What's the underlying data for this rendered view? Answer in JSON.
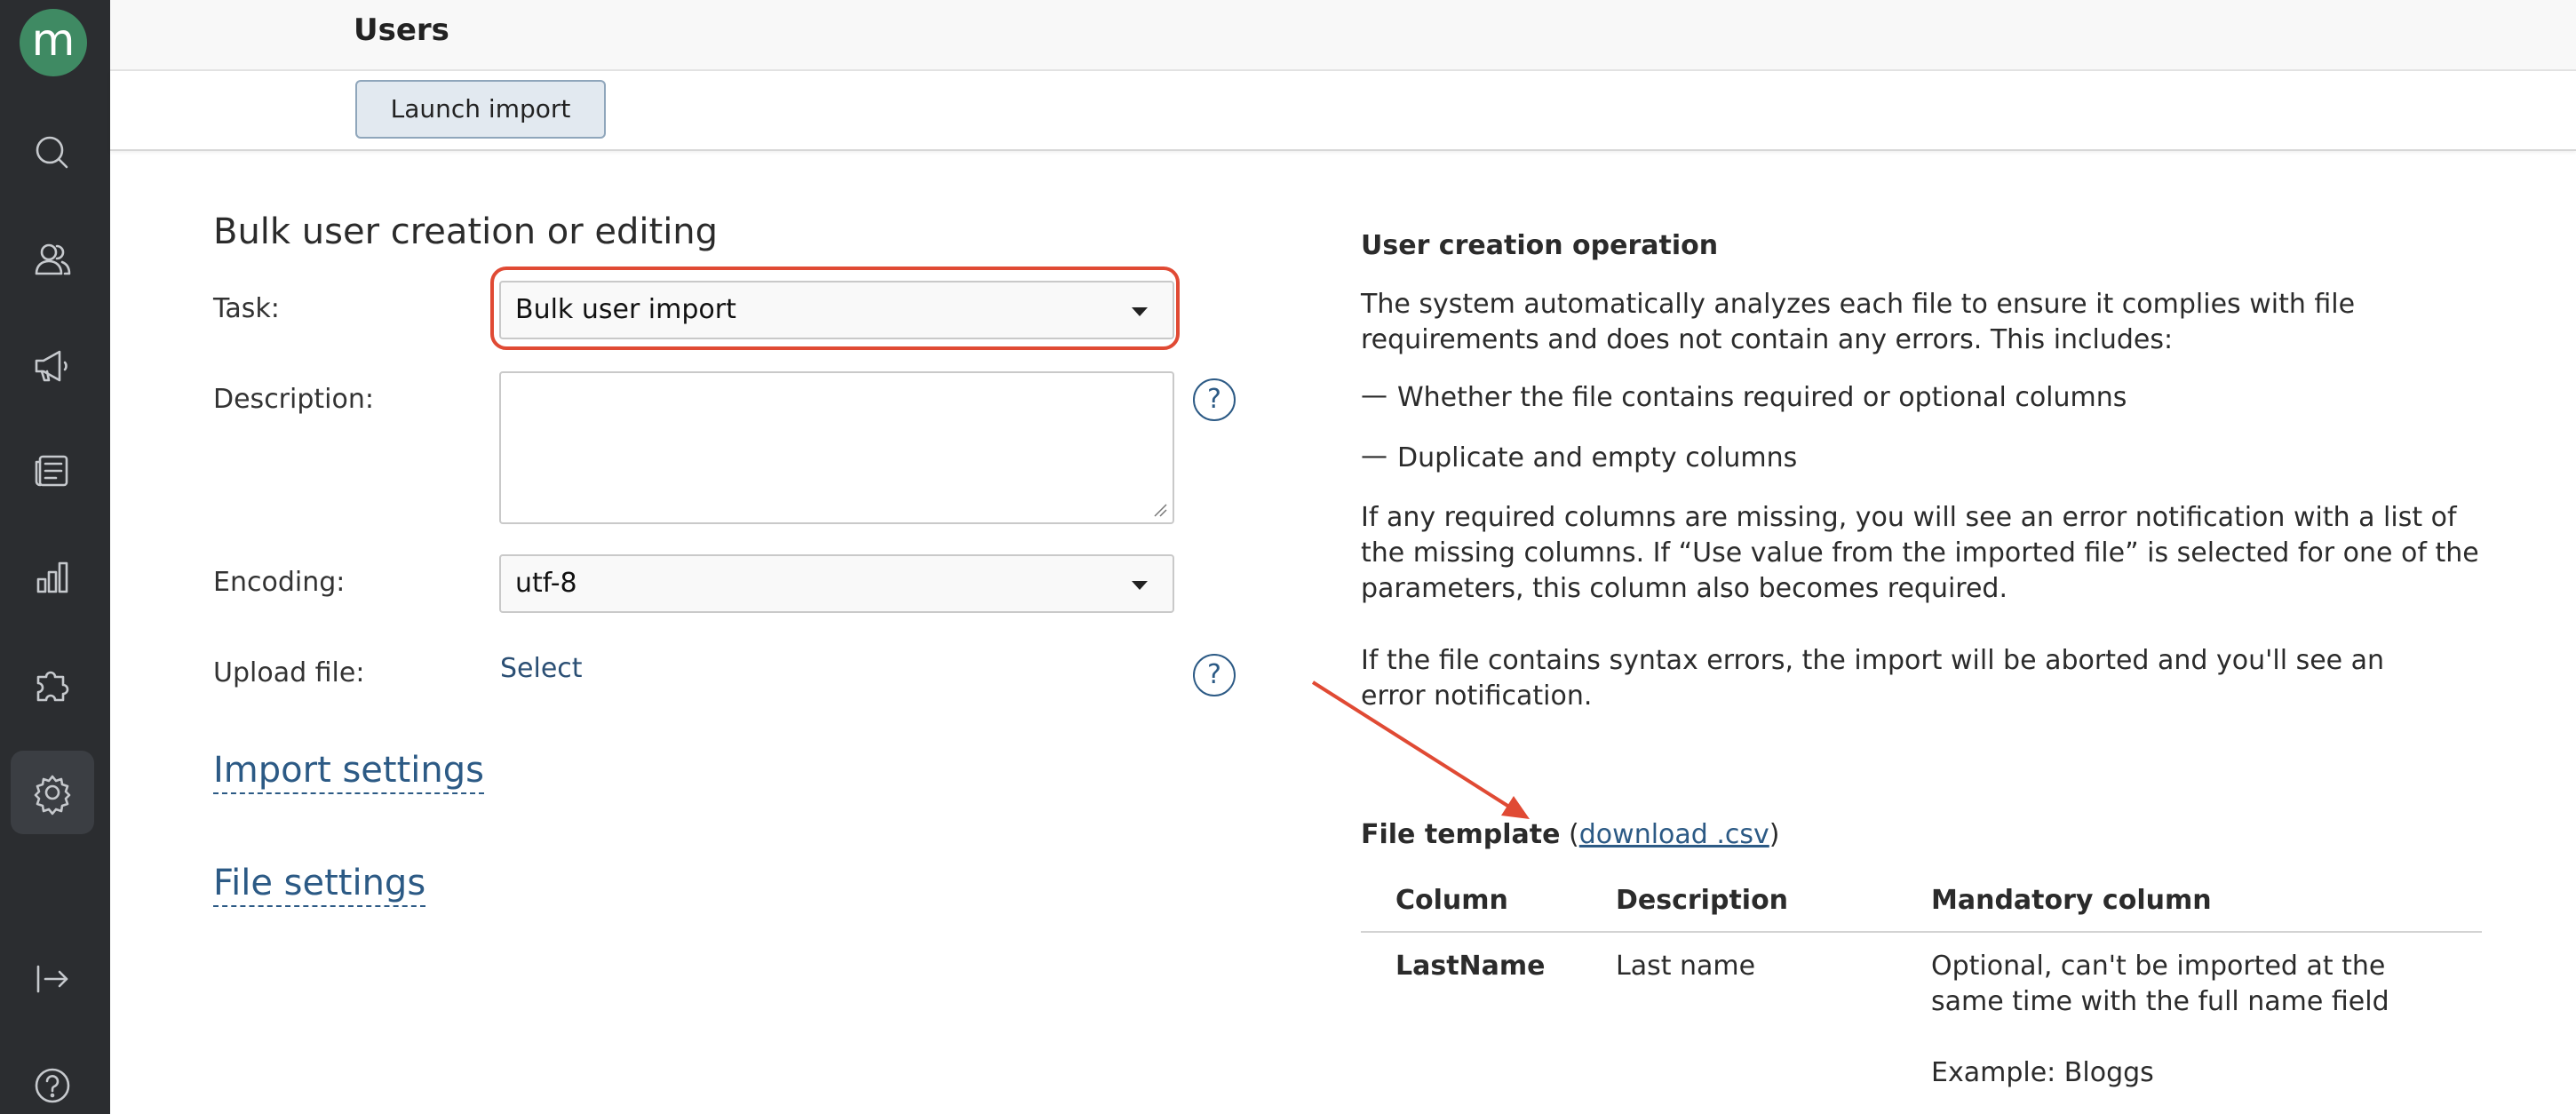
{
  "app": {
    "logo_letter": "m",
    "header_title": "Users"
  },
  "sidebar": {
    "items": [
      {
        "icon": "search-icon"
      },
      {
        "icon": "users-icon"
      },
      {
        "icon": "megaphone-icon"
      },
      {
        "icon": "news-icon"
      },
      {
        "icon": "bar-chart-icon"
      },
      {
        "icon": "puzzle-icon"
      },
      {
        "icon": "gear-icon",
        "active": true
      },
      {
        "icon": "logout-icon"
      },
      {
        "icon": "help-icon"
      }
    ]
  },
  "toolbar": {
    "launch_label": "Launch import"
  },
  "form": {
    "title": "Bulk user creation or editing",
    "task_label": "Task:",
    "task_value": "Bulk user import",
    "description_label": "Description:",
    "description_value": "",
    "encoding_label": "Encoding:",
    "encoding_value": "utf-8",
    "upload_label": "Upload file:",
    "upload_link": "Select",
    "help_glyph": "?",
    "import_settings": "Import settings",
    "file_settings": "File settings"
  },
  "info": {
    "heading": "User creation operation",
    "intro": "The system automatically analyzes each file to ensure it complies with file requirements and does not contain any errors. This includes:",
    "bullet_dash": "—",
    "bullets": [
      "Whether the file contains required or optional columns",
      "Duplicate and empty columns"
    ],
    "missing_note": "If any required columns are missing, you will see an error notification with a list of the missing columns. If “Use value from the imported file” is selected for one of the parameters, this column also becomes required.",
    "syntax_note": "If the file contains syntax errors, the import will be aborted and you'll see an error notification.",
    "template_label": "File template",
    "template_open": "(",
    "template_link": "download .csv",
    "template_close": ")"
  },
  "template_table": {
    "headers": [
      "Column",
      "Description",
      "Mandatory column"
    ],
    "rows": [
      {
        "column": "LastName",
        "description": "Last name",
        "mandatory": "Optional, can't be imported at the same time with the full name field",
        "example": "Example: Bloggs"
      }
    ]
  },
  "colors": {
    "sidebar": "#2b2d30",
    "accent": "#2c5a85",
    "annotation": "#e04a34",
    "logo": "#3f8a63"
  }
}
